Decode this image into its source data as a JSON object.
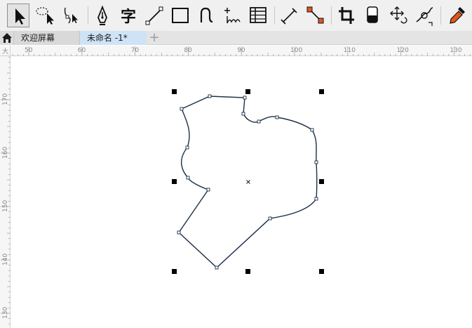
{
  "tabs": {
    "welcome_label": "欢迎屏幕",
    "document_label": "未命名 -1*",
    "add_symbol": "+"
  },
  "ruler": {
    "unit_label": "大",
    "top_ticks": [
      "50",
      "60",
      "70",
      "80",
      "90",
      "100",
      "110",
      "120",
      "130"
    ],
    "left_ticks": [
      "170",
      "160",
      "150",
      "140",
      "130"
    ]
  },
  "toolbar": {
    "tools": [
      "pick-tool",
      "freehand-pick-tool",
      "shape-tool",
      "pen-tool",
      "text-tool",
      "line-connector-tool",
      "rectangle-tool",
      "artistic-media-tool",
      "spray-tool",
      "table-tool",
      "dimension-tool",
      "connector-tool",
      "crop-tool",
      "eraser-tool",
      "transform-tool",
      "smear-tool",
      "eyedropper-tool"
    ],
    "text_tool_glyph": "字"
  },
  "colors": {
    "accent": "#1f6fb5",
    "curve_stroke": "#1c2f46",
    "handle": "#000000",
    "tab_active": "#cfe3f6"
  }
}
